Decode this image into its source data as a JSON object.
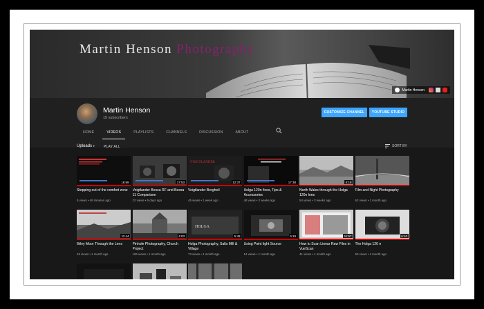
{
  "banner": {
    "title_main": "Martin Henson ",
    "title_accent": "Photography",
    "link_label": "Martin Henson"
  },
  "channel": {
    "name": "Martin Henson",
    "subscribers": "15 subscribers",
    "customize_label": "CUSTOMIZE CHANNEL",
    "studio_label": "YOUTUBE STUDIO"
  },
  "tabs": [
    "HOME",
    "VIDEOS",
    "PLAYLISTS",
    "CHANNELS",
    "DISCUSSION",
    "ABOUT"
  ],
  "active_tab": "VIDEOS",
  "toolbar": {
    "uploads_label": "Uploads",
    "play_all_label": "PLAY ALL",
    "sort_label": "SORT BY"
  },
  "videos": [
    {
      "title": "Stepping out of the comfort zone",
      "views": "5 views",
      "age": "48 minutes ago",
      "duration": "16:59",
      "theme": "dark-red"
    },
    {
      "title": "Voigtlander Bessa RF and Bessa 11 Comparison",
      "views": "22 views",
      "age": "5 days ago",
      "duration": "17:53",
      "theme": "cameras"
    },
    {
      "title": "Voigtlander Bergheil",
      "views": "45 views",
      "age": "1 week ago",
      "duration": "12:37",
      "theme": "camera-red"
    },
    {
      "title": "Holga 120n fixes, Tips & Accessories",
      "views": "48 views",
      "age": "2 weeks ago",
      "duration": "17:38",
      "theme": "holga"
    },
    {
      "title": "North Wales through the Holga 120n lens",
      "views": "54 views",
      "age": "3 weeks ago",
      "duration": "4:18",
      "theme": "landscape"
    },
    {
      "title": "Film and Night Photography",
      "views": "62 views",
      "age": "1 month ago",
      "duration": "",
      "theme": "street"
    },
    {
      "title": "Ilkley Moor Through the Lens",
      "views": "45 views",
      "age": "1 month ago",
      "duration": "11:44",
      "theme": "moor"
    },
    {
      "title": "Pinhole Photography, Church Project",
      "views": "106 views",
      "age": "1 month ago",
      "duration": "4:03",
      "theme": "church"
    },
    {
      "title": "Holga Photography, Salts Mill & Village",
      "views": "73 views",
      "age": "1 month ago",
      "duration": "5:48",
      "theme": "mill"
    },
    {
      "title": "Using Point light Source",
      "views": "14 views",
      "age": "1 month ago",
      "duration": "9:19",
      "theme": "light"
    },
    {
      "title": "How to Scan Linear Raw Files in VueScan",
      "views": "41 views",
      "age": "1 month ago",
      "duration": "11:57",
      "theme": "scan"
    },
    {
      "title": "The Holga 120 n",
      "views": "50 views",
      "age": "1 month ago",
      "duration": "6:10",
      "theme": "holga-cam"
    },
    {
      "title": "",
      "views": "",
      "age": "",
      "duration": "",
      "theme": "dark"
    },
    {
      "title": "",
      "views": "",
      "age": "",
      "duration": "",
      "theme": "bw-objects"
    },
    {
      "title": "",
      "views": "",
      "age": "",
      "duration": "",
      "theme": "trees"
    }
  ],
  "colors": {
    "accent_blue": "#3ea6ff",
    "progress_red": "#cc0000",
    "banner_accent": "#8a1f70",
    "background": "#181818"
  }
}
